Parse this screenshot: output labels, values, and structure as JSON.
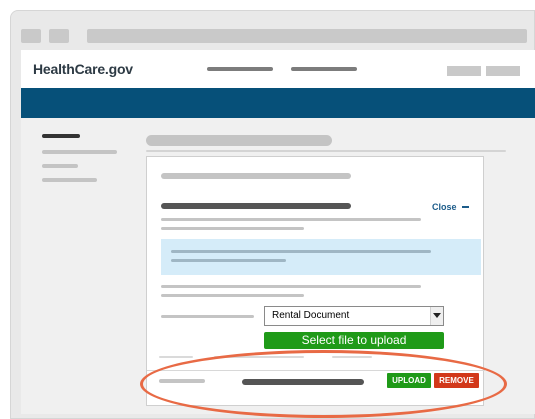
{
  "header": {
    "logo": "HealthCare.gov"
  },
  "modal": {
    "close_label": "Close",
    "select": {
      "selected_value": "Rental Document"
    },
    "select_file_label": "Select file to upload",
    "upload_label": "UPLOAD",
    "remove_label": "REMOVE"
  },
  "colors": {
    "brand_band": "#065079",
    "info_box": "#d5ecf9",
    "primary_green": "#1f9a18",
    "danger_red": "#d2381a",
    "link_blue": "#1c5c8a",
    "highlight_ring": "#e86a45"
  }
}
